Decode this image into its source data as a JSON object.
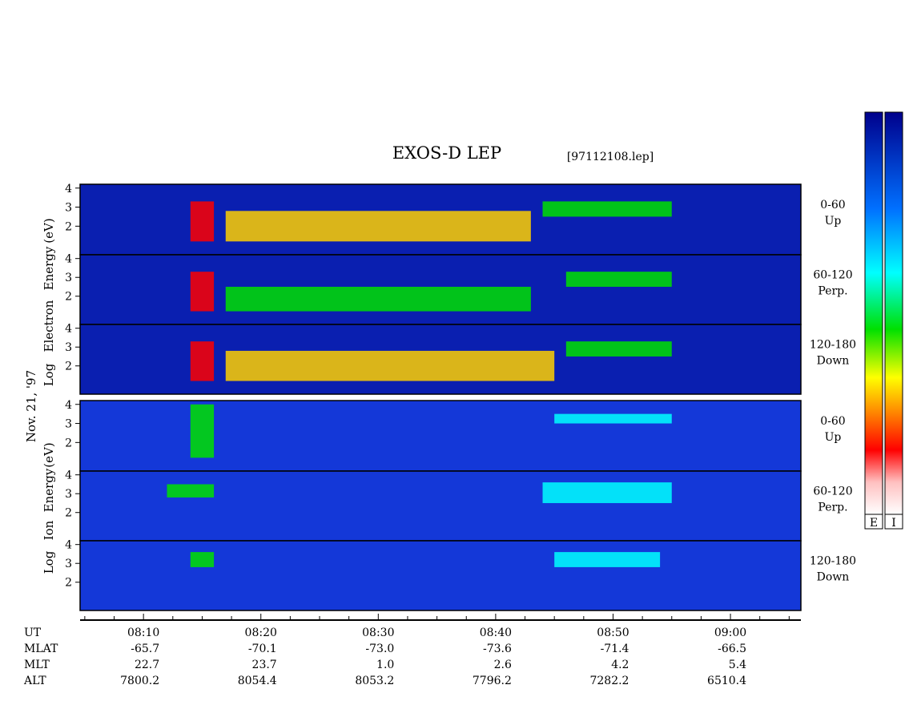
{
  "title": "EXOS-D LEP",
  "file_label": "[97112108.lep]",
  "date_label": "Nov. 21, '97",
  "groups": {
    "electron": [
      "Log",
      "Electron",
      "Energy",
      "(eV)"
    ],
    "ion": [
      "Log",
      "Ion",
      "Energy",
      "(eV)"
    ]
  },
  "colorbar": {
    "labels": [
      "E",
      "I"
    ],
    "colors": [
      "#ffffff",
      "#ff0000",
      "#ffd000",
      "#00e000",
      "#00ffff",
      "#0050ff",
      "#00008c"
    ]
  },
  "chart_data": {
    "type": "heatmap",
    "panels": [
      {
        "species": "Electron",
        "pitch_angle": "0-60",
        "direction": "Up",
        "features": [
          {
            "t_start": "08:14",
            "t_end": "08:16",
            "log_energy_range": [
              1.2,
              3.3
            ],
            "intensity": "high"
          },
          {
            "t_start": "08:17",
            "t_end": "08:43",
            "log_energy_range": [
              1.2,
              2.8
            ],
            "intensity": "medium-high"
          },
          {
            "t_start": "08:44",
            "t_end": "08:55",
            "log_energy_range": [
              2.5,
              3.3
            ],
            "intensity": "medium"
          }
        ]
      },
      {
        "species": "Electron",
        "pitch_angle": "60-120",
        "direction": "Perp.",
        "features": [
          {
            "t_start": "08:14",
            "t_end": "08:16",
            "log_energy_range": [
              1.2,
              3.3
            ],
            "intensity": "high"
          },
          {
            "t_start": "08:17",
            "t_end": "08:43",
            "log_energy_range": [
              1.2,
              2.5
            ],
            "intensity": "medium"
          },
          {
            "t_start": "08:46",
            "t_end": "08:55",
            "log_energy_range": [
              2.5,
              3.3
            ],
            "intensity": "medium"
          }
        ]
      },
      {
        "species": "Electron",
        "pitch_angle": "120-180",
        "direction": "Down",
        "features": [
          {
            "t_start": "08:14",
            "t_end": "08:16",
            "log_energy_range": [
              1.2,
              3.3
            ],
            "intensity": "high"
          },
          {
            "t_start": "08:17",
            "t_end": "08:45",
            "log_energy_range": [
              1.2,
              2.8
            ],
            "intensity": "medium-high"
          },
          {
            "t_start": "08:46",
            "t_end": "08:55",
            "log_energy_range": [
              2.5,
              3.3
            ],
            "intensity": "medium"
          }
        ]
      },
      {
        "species": "Ion",
        "pitch_angle": "0-60",
        "direction": "Up",
        "features": [
          {
            "t_start": "08:14",
            "t_end": "08:16",
            "log_energy_range": [
              1.2,
              4.0
            ],
            "intensity": "medium"
          },
          {
            "t_start": "08:45",
            "t_end": "08:55",
            "log_energy_range": [
              3.0,
              3.5
            ],
            "intensity": "low"
          }
        ]
      },
      {
        "species": "Ion",
        "pitch_angle": "60-120",
        "direction": "Perp.",
        "features": [
          {
            "t_start": "08:12",
            "t_end": "08:16",
            "log_energy_range": [
              2.8,
              3.5
            ],
            "intensity": "medium"
          },
          {
            "t_start": "08:44",
            "t_end": "08:55",
            "log_energy_range": [
              2.5,
              3.6
            ],
            "intensity": "medium-low"
          }
        ]
      },
      {
        "species": "Ion",
        "pitch_angle": "120-180",
        "direction": "Down",
        "features": [
          {
            "t_start": "08:14",
            "t_end": "08:16",
            "log_energy_range": [
              2.8,
              3.6
            ],
            "intensity": "medium"
          },
          {
            "t_start": "08:45",
            "t_end": "08:54",
            "log_energy_range": [
              2.8,
              3.6
            ],
            "intensity": "medium-low"
          }
        ]
      }
    ],
    "x_axis": {
      "label": "UT",
      "rows": [
        {
          "name": "UT",
          "values": [
            "08:10",
            "08:20",
            "08:30",
            "08:40",
            "08:50",
            "09:00"
          ]
        },
        {
          "name": "MLAT",
          "values": [
            "-65.7",
            "-70.1",
            "-73.0",
            "-73.6",
            "-71.4",
            "-66.5"
          ]
        },
        {
          "name": "MLT",
          "values": [
            "22.7",
            "23.7",
            "1.0",
            "2.6",
            "4.2",
            "5.4"
          ]
        },
        {
          "name": "ALT",
          "values": [
            "7800.2",
            "8054.4",
            "8053.2",
            "7796.2",
            "7282.2",
            "6510.4"
          ]
        }
      ]
    },
    "y_axis": {
      "label": "Log Energy (eV)",
      "ticks": [
        "2",
        "3",
        "4"
      ]
    },
    "colors": [
      "#00008c",
      "#0050ff",
      "#00ffff",
      "#00e000",
      "#ffd000",
      "#ff0000",
      "#ffffff"
    ]
  }
}
